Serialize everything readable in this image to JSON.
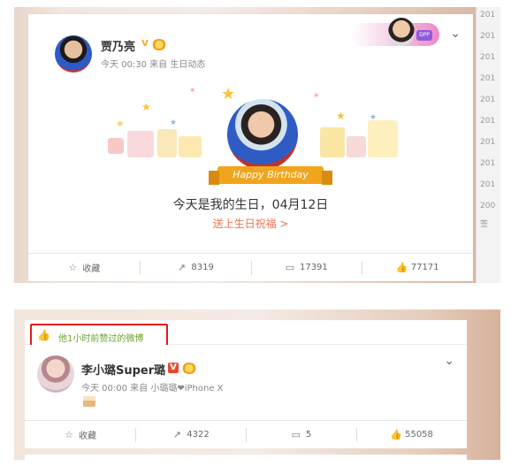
{
  "post1": {
    "user_name": "贾乃亮",
    "v_badge": "V",
    "meta": "今天 00:30 来自 生日动态",
    "ribbon_text": "Happy Birthday",
    "birthday_text": "今天是我的生日，04月12日",
    "birthday_link": "送上生日祝福 >",
    "banner_tag": "DPP",
    "actions": [
      {
        "icon": "star-icon",
        "glyph": "☆",
        "label": "收藏"
      },
      {
        "icon": "share-icon",
        "glyph": "↗",
        "label": "8319"
      },
      {
        "icon": "comment-icon",
        "glyph": "▭",
        "label": "17391"
      },
      {
        "icon": "like-icon",
        "glyph": "👍",
        "label": "77171"
      }
    ],
    "year_labels": [
      "201",
      "201",
      "201",
      "201",
      "201",
      "201",
      "201",
      "201",
      "201",
      "200",
      "签"
    ]
  },
  "post2": {
    "liked_banner_text": "他1小时前赞过的微博",
    "user_name": "李小璐Super璐",
    "v_badge": "V",
    "meta": "今天 00:00 来自 小璐璐❤iPhone X",
    "actions": [
      {
        "icon": "star-icon",
        "glyph": "☆",
        "label": "收藏"
      },
      {
        "icon": "share-icon",
        "glyph": "↗",
        "label": "4322"
      },
      {
        "icon": "comment-icon",
        "glyph": "▭",
        "label": "5"
      },
      {
        "icon": "like-icon",
        "glyph": "👍",
        "label": "55058"
      }
    ]
  },
  "colors": {
    "accent_orange": "#eb7350",
    "liked_green": "#6ba32b",
    "highlight_red": "#e01b1b",
    "ribbon": "#f0a51c"
  }
}
